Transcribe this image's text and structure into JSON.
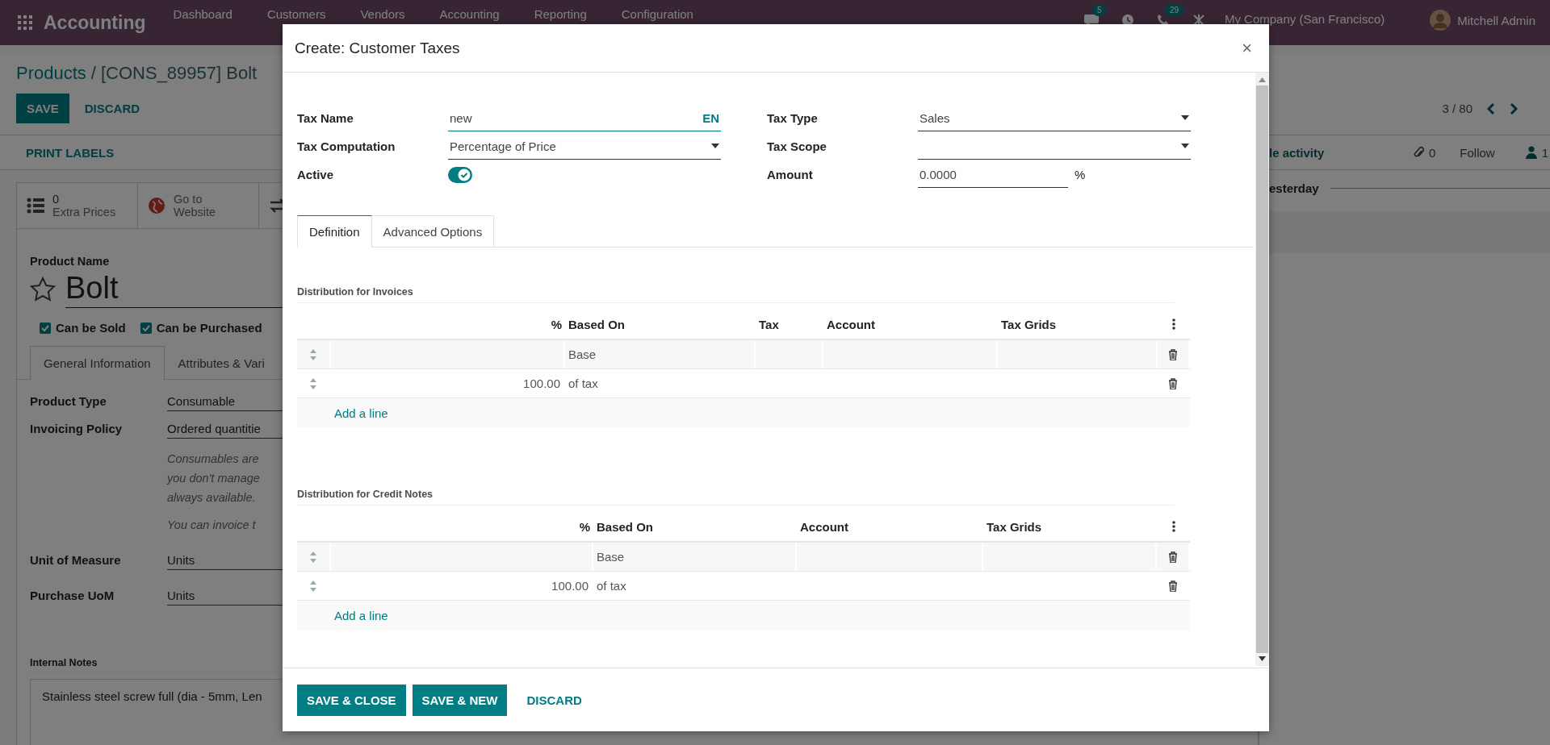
{
  "topbar": {
    "app_name": "Accounting",
    "menu": [
      "Dashboard",
      "Customers",
      "Vendors",
      "Accounting",
      "Reporting",
      "Configuration"
    ],
    "messages_badge": "5",
    "activities_badge": "29",
    "company": "My Company (San Francisco)",
    "user": "Mitchell Admin"
  },
  "control_panel": {
    "breadcrumb_link": "Products",
    "breadcrumb_separator": "/",
    "breadcrumb_current": "[CONS_89957] Bolt",
    "buttons": [
      {
        "label": "SAVE",
        "kind": "primary"
      },
      {
        "label": "DISCARD",
        "kind": "link"
      }
    ],
    "pager": "3 / 80",
    "print_labels": "PRINT LABELS"
  },
  "chatter": {
    "schedule": "le activity",
    "attachments": "0",
    "follow": "Follow",
    "followers": "1",
    "date_separator": "esterday"
  },
  "form": {
    "smart_buttons": [
      {
        "kind": "list",
        "count": "0",
        "label": "Extra Prices"
      },
      {
        "kind": "globe",
        "label": "Go to Website"
      },
      {
        "kind": "arrows"
      }
    ],
    "name_label": "Product Name",
    "name": "Bolt",
    "favorite": false,
    "checkboxes": [
      {
        "label": "Can be Sold",
        "checked": true
      },
      {
        "label": "Can be Purchased",
        "checked": true
      }
    ],
    "tabs": [
      {
        "label": "General Information",
        "selected": true
      },
      {
        "label": "Attributes & Vari",
        "selected": false
      }
    ],
    "fields_top": [
      {
        "label": "Product Type",
        "value": "Consumable"
      },
      {
        "label": "Invoicing Policy",
        "value": "Ordered quantitie"
      }
    ],
    "help_lines": [
      "Consumables are",
      "you don't manage",
      "always available."
    ],
    "help_extra": "You can invoice t",
    "fields_bottom": [
      {
        "label": "Unit of Measure",
        "value": "Units"
      },
      {
        "label": "Purchase UoM",
        "value": "Units"
      }
    ],
    "notes_label": "Internal Notes",
    "notes": "Stainless steel screw full (dia - 5mm, Len"
  },
  "modal": {
    "title": "Create: Customer Taxes",
    "close": "×",
    "fields": [
      {
        "kind": "text",
        "label": "Tax Name",
        "value": "new",
        "lang": "EN"
      },
      {
        "kind": "select",
        "label": "Tax Type",
        "value": "Sales"
      },
      {
        "kind": "select",
        "label": "Tax Computation",
        "value": "Percentage of Price"
      },
      {
        "kind": "select",
        "label": "Tax Scope"
      },
      {
        "kind": "toggle",
        "label": "Active",
        "on": true
      },
      {
        "kind": "number",
        "label": "Amount",
        "value": "0.0000",
        "suffix": "%"
      }
    ],
    "tabs": [
      {
        "label": "Definition",
        "selected": true
      },
      {
        "label": "Advanced Options",
        "selected": false
      }
    ],
    "sections": [
      {
        "title": "Distribution for Invoices",
        "columns": [
          "%",
          "Based On",
          "Tax",
          "Account",
          "Tax Grids"
        ],
        "rows": [
          {
            "based_on": "Base"
          },
          {
            "percent": "100.00",
            "based_on": "of tax"
          }
        ],
        "add_line": "Add a line"
      },
      {
        "title": "Distribution for Credit Notes",
        "columns": [
          "%",
          "Based On",
          "Account",
          "Tax Grids"
        ],
        "rows": [
          {
            "based_on": "Base"
          },
          {
            "percent": "100.00",
            "based_on": "of tax"
          }
        ],
        "add_line": "Add a line"
      }
    ],
    "buttons": [
      {
        "label": "SAVE & CLOSE",
        "kind": "primary"
      },
      {
        "label": "SAVE & NEW",
        "kind": "primary"
      },
      {
        "label": "DISCARD",
        "kind": "link"
      }
    ]
  }
}
